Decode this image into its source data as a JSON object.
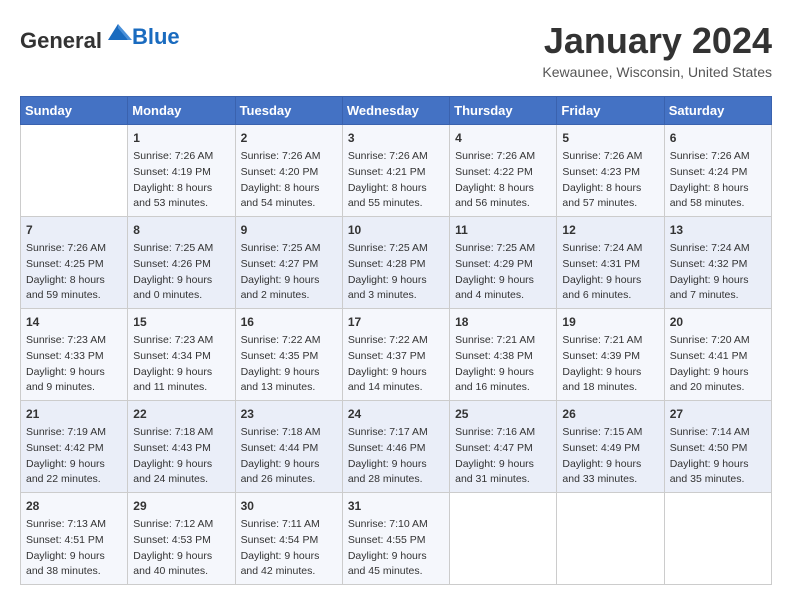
{
  "header": {
    "logo_general": "General",
    "logo_blue": "Blue",
    "title": "January 2024",
    "subtitle": "Kewaunee, Wisconsin, United States"
  },
  "weekdays": [
    "Sunday",
    "Monday",
    "Tuesday",
    "Wednesday",
    "Thursday",
    "Friday",
    "Saturday"
  ],
  "weeks": [
    [
      {
        "day": "",
        "content": ""
      },
      {
        "day": "1",
        "content": "Sunrise: 7:26 AM\nSunset: 4:19 PM\nDaylight: 8 hours\nand 53 minutes."
      },
      {
        "day": "2",
        "content": "Sunrise: 7:26 AM\nSunset: 4:20 PM\nDaylight: 8 hours\nand 54 minutes."
      },
      {
        "day": "3",
        "content": "Sunrise: 7:26 AM\nSunset: 4:21 PM\nDaylight: 8 hours\nand 55 minutes."
      },
      {
        "day": "4",
        "content": "Sunrise: 7:26 AM\nSunset: 4:22 PM\nDaylight: 8 hours\nand 56 minutes."
      },
      {
        "day": "5",
        "content": "Sunrise: 7:26 AM\nSunset: 4:23 PM\nDaylight: 8 hours\nand 57 minutes."
      },
      {
        "day": "6",
        "content": "Sunrise: 7:26 AM\nSunset: 4:24 PM\nDaylight: 8 hours\nand 58 minutes."
      }
    ],
    [
      {
        "day": "7",
        "content": "Sunrise: 7:26 AM\nSunset: 4:25 PM\nDaylight: 8 hours\nand 59 minutes."
      },
      {
        "day": "8",
        "content": "Sunrise: 7:25 AM\nSunset: 4:26 PM\nDaylight: 9 hours\nand 0 minutes."
      },
      {
        "day": "9",
        "content": "Sunrise: 7:25 AM\nSunset: 4:27 PM\nDaylight: 9 hours\nand 2 minutes."
      },
      {
        "day": "10",
        "content": "Sunrise: 7:25 AM\nSunset: 4:28 PM\nDaylight: 9 hours\nand 3 minutes."
      },
      {
        "day": "11",
        "content": "Sunrise: 7:25 AM\nSunset: 4:29 PM\nDaylight: 9 hours\nand 4 minutes."
      },
      {
        "day": "12",
        "content": "Sunrise: 7:24 AM\nSunset: 4:31 PM\nDaylight: 9 hours\nand 6 minutes."
      },
      {
        "day": "13",
        "content": "Sunrise: 7:24 AM\nSunset: 4:32 PM\nDaylight: 9 hours\nand 7 minutes."
      }
    ],
    [
      {
        "day": "14",
        "content": "Sunrise: 7:23 AM\nSunset: 4:33 PM\nDaylight: 9 hours\nand 9 minutes."
      },
      {
        "day": "15",
        "content": "Sunrise: 7:23 AM\nSunset: 4:34 PM\nDaylight: 9 hours\nand 11 minutes."
      },
      {
        "day": "16",
        "content": "Sunrise: 7:22 AM\nSunset: 4:35 PM\nDaylight: 9 hours\nand 13 minutes."
      },
      {
        "day": "17",
        "content": "Sunrise: 7:22 AM\nSunset: 4:37 PM\nDaylight: 9 hours\nand 14 minutes."
      },
      {
        "day": "18",
        "content": "Sunrise: 7:21 AM\nSunset: 4:38 PM\nDaylight: 9 hours\nand 16 minutes."
      },
      {
        "day": "19",
        "content": "Sunrise: 7:21 AM\nSunset: 4:39 PM\nDaylight: 9 hours\nand 18 minutes."
      },
      {
        "day": "20",
        "content": "Sunrise: 7:20 AM\nSunset: 4:41 PM\nDaylight: 9 hours\nand 20 minutes."
      }
    ],
    [
      {
        "day": "21",
        "content": "Sunrise: 7:19 AM\nSunset: 4:42 PM\nDaylight: 9 hours\nand 22 minutes."
      },
      {
        "day": "22",
        "content": "Sunrise: 7:18 AM\nSunset: 4:43 PM\nDaylight: 9 hours\nand 24 minutes."
      },
      {
        "day": "23",
        "content": "Sunrise: 7:18 AM\nSunset: 4:44 PM\nDaylight: 9 hours\nand 26 minutes."
      },
      {
        "day": "24",
        "content": "Sunrise: 7:17 AM\nSunset: 4:46 PM\nDaylight: 9 hours\nand 28 minutes."
      },
      {
        "day": "25",
        "content": "Sunrise: 7:16 AM\nSunset: 4:47 PM\nDaylight: 9 hours\nand 31 minutes."
      },
      {
        "day": "26",
        "content": "Sunrise: 7:15 AM\nSunset: 4:49 PM\nDaylight: 9 hours\nand 33 minutes."
      },
      {
        "day": "27",
        "content": "Sunrise: 7:14 AM\nSunset: 4:50 PM\nDaylight: 9 hours\nand 35 minutes."
      }
    ],
    [
      {
        "day": "28",
        "content": "Sunrise: 7:13 AM\nSunset: 4:51 PM\nDaylight: 9 hours\nand 38 minutes."
      },
      {
        "day": "29",
        "content": "Sunrise: 7:12 AM\nSunset: 4:53 PM\nDaylight: 9 hours\nand 40 minutes."
      },
      {
        "day": "30",
        "content": "Sunrise: 7:11 AM\nSunset: 4:54 PM\nDaylight: 9 hours\nand 42 minutes."
      },
      {
        "day": "31",
        "content": "Sunrise: 7:10 AM\nSunset: 4:55 PM\nDaylight: 9 hours\nand 45 minutes."
      },
      {
        "day": "",
        "content": ""
      },
      {
        "day": "",
        "content": ""
      },
      {
        "day": "",
        "content": ""
      }
    ]
  ]
}
